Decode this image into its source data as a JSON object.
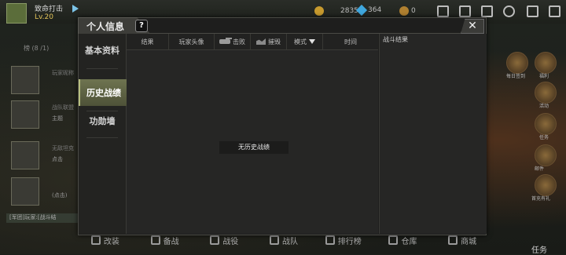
{
  "topbar": {
    "player_name": "致命打击",
    "player_level": "Lv.20",
    "gold": "28350",
    "diamond": "364",
    "medal": "0"
  },
  "lobby": {
    "list_title": "榜 (8 /1)",
    "rows": [
      {
        "title": "玩家昵称",
        "sub": ""
      },
      {
        "title": "战队联盟",
        "sub": "主题"
      },
      {
        "title": "无敌坦克",
        "sub": "点击"
      },
      {
        "title": "",
        "sub": "(点击)"
      }
    ],
    "chat": "[军团]玩家:[战斗结",
    "right_labels": [
      "每日签到",
      "福利",
      "活动",
      "任务",
      "邮件",
      "首充有礼"
    ],
    "task": "任务"
  },
  "bottom_nav": [
    {
      "label": "改装"
    },
    {
      "label": "备战"
    },
    {
      "label": "战役"
    },
    {
      "label": "战队"
    },
    {
      "label": "排行榜"
    },
    {
      "label": "仓库"
    },
    {
      "label": "商城"
    }
  ],
  "modal": {
    "title": "个人信息",
    "help": "?",
    "close": "✕",
    "tabs": [
      {
        "label": "基本资料"
      },
      {
        "label": "历史战绩"
      },
      {
        "label": "功勋墙"
      }
    ],
    "columns": {
      "result": "结果",
      "avatar": "玩家头像",
      "kills": "击败",
      "destroys": "摧毁",
      "mode": "模式",
      "time": "时间"
    },
    "empty_message": "无历史战绩",
    "result_panel_title": "战斗结果"
  },
  "colors": {
    "active_tab": "#6e7450",
    "gold": "#c79a2e",
    "diamond": "#3fa7de"
  }
}
